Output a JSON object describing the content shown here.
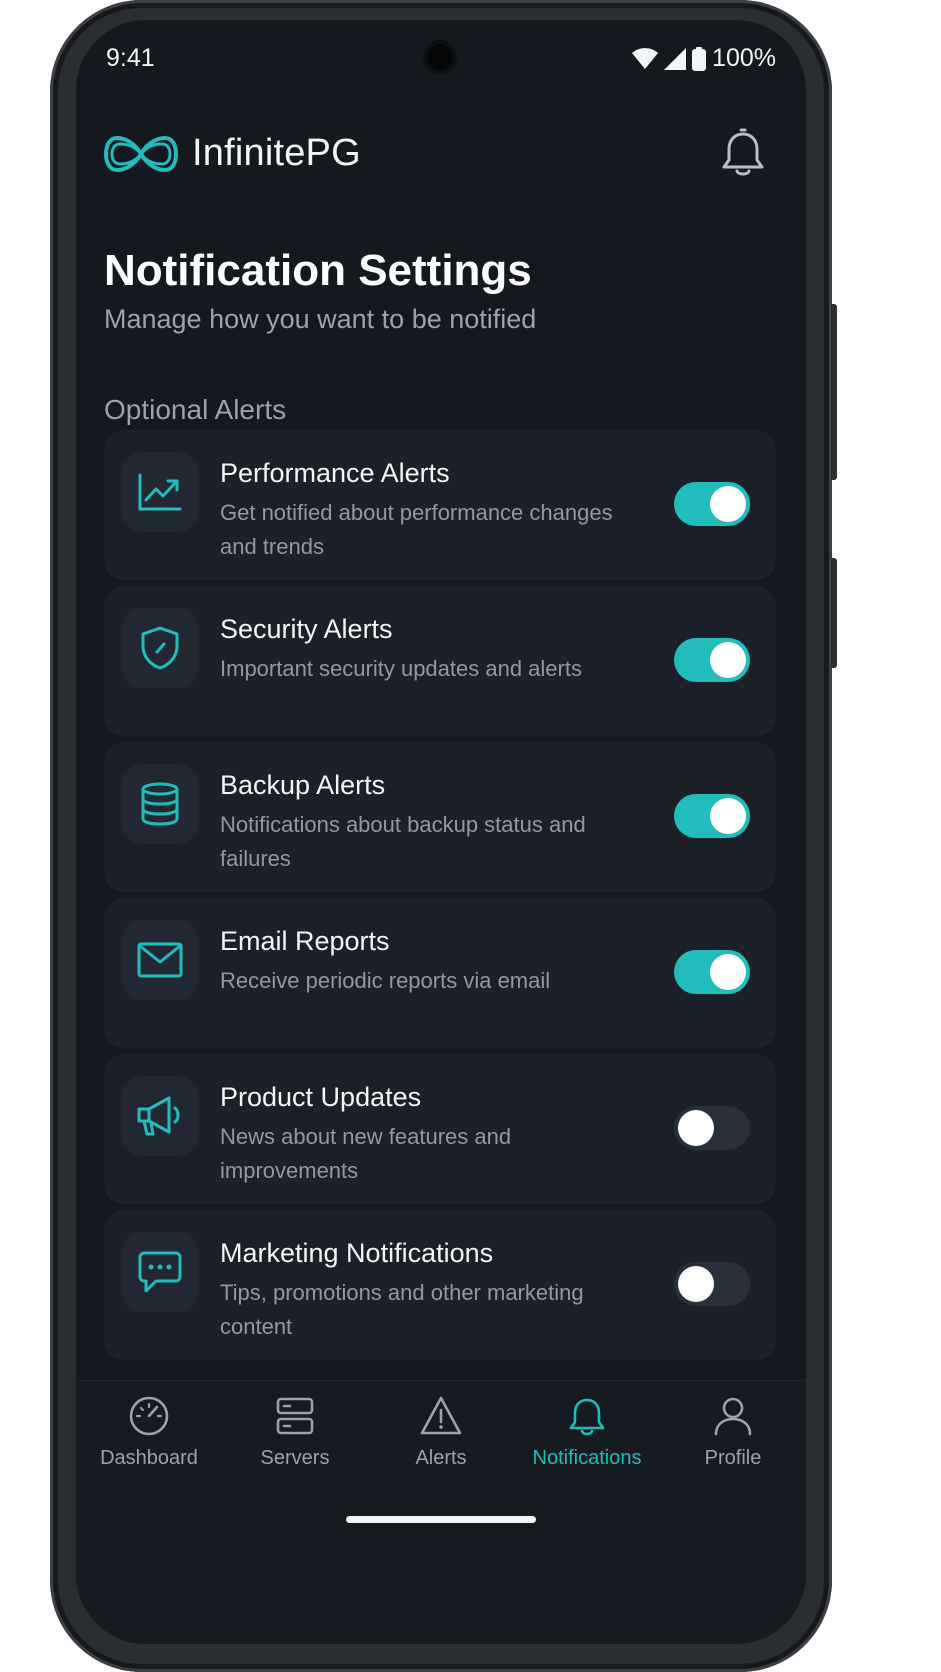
{
  "status_bar": {
    "time": "9:41",
    "battery": "100%"
  },
  "header": {
    "brand": "InfinitePG"
  },
  "page": {
    "title": "Notification Settings",
    "subtitle": "Manage how you want to be notified",
    "section_label": "Optional Alerts"
  },
  "settings": [
    {
      "title": "Performance Alerts",
      "description": "Get notified about performance changes and trends",
      "enabled": true,
      "icon": "chart-trending-up-icon"
    },
    {
      "title": "Security Alerts",
      "description": "Important security updates and alerts",
      "enabled": true,
      "icon": "shield-check-icon"
    },
    {
      "title": "Backup Alerts",
      "description": "Notifications about backup status and failures",
      "enabled": true,
      "icon": "database-icon"
    },
    {
      "title": "Email Reports",
      "description": "Receive periodic reports via email",
      "enabled": true,
      "icon": "envelope-icon"
    },
    {
      "title": "Product Updates",
      "description": "News about new features and improvements",
      "enabled": false,
      "icon": "megaphone-icon"
    },
    {
      "title": "Marketing Notifications",
      "description": "Tips, promotions and other marketing content",
      "enabled": false,
      "icon": "chat-bubble-icon"
    }
  ],
  "nav": {
    "items": [
      {
        "label": "Dashboard",
        "icon": "gauge-icon"
      },
      {
        "label": "Servers",
        "icon": "server-icon"
      },
      {
        "label": "Alerts",
        "icon": "warning-triangle-icon"
      },
      {
        "label": "Notifications",
        "icon": "bell-icon"
      },
      {
        "label": "Profile",
        "icon": "person-icon"
      }
    ],
    "active": "Notifications"
  },
  "colors": {
    "accent": "#22bcbc",
    "background": "#141920",
    "card": "#1c2129"
  }
}
